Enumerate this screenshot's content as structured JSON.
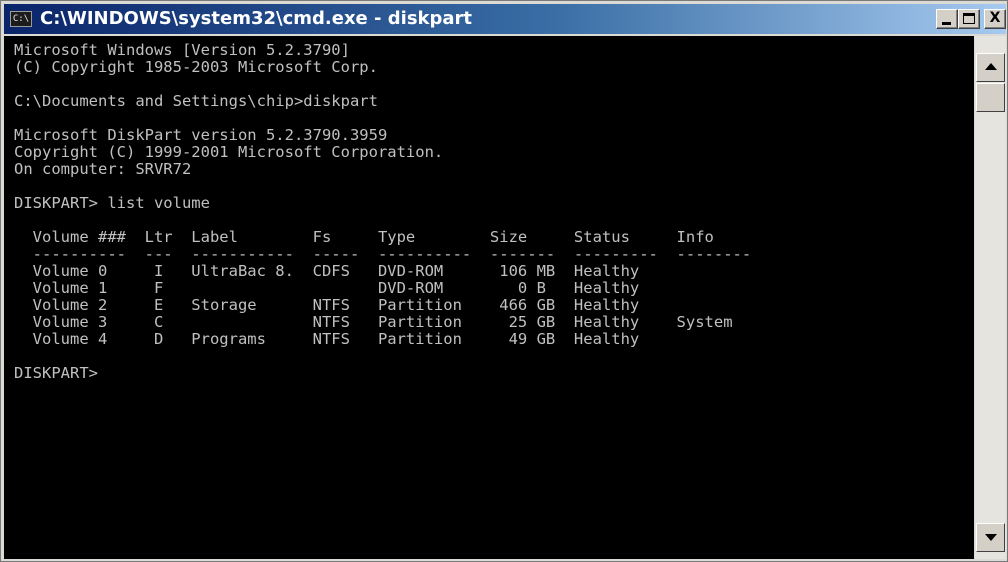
{
  "window": {
    "title": "C:\\WINDOWS\\system32\\cmd.exe - diskpart",
    "icon_text": "C:\\",
    "minimize_label": "",
    "maximize_label": "",
    "close_label": "X"
  },
  "console": {
    "lines": [
      "Microsoft Windows [Version 5.2.3790]",
      "(C) Copyright 1985-2003 Microsoft Corp.",
      "",
      "C:\\Documents and Settings\\chip>diskpart",
      "",
      "Microsoft DiskPart version 5.2.3790.3959",
      "Copyright (C) 1999-2001 Microsoft Corporation.",
      "On computer: SRVR72",
      "",
      "DISKPART> list volume",
      "",
      "  Volume ###  Ltr  Label        Fs     Type        Size     Status     Info",
      "  ----------  ---  -----------  -----  ----------  -------  ---------  --------",
      "  Volume 0     I   UltraBac 8.  CDFS   DVD-ROM      106 MB  Healthy",
      "  Volume 1     F                       DVD-ROM        0 B   Healthy",
      "  Volume 2     E   Storage      NTFS   Partition    466 GB  Healthy",
      "  Volume 3     C                NTFS   Partition     25 GB  Healthy    System",
      "  Volume 4     D   Programs     NTFS   Partition     49 GB  Healthy",
      "",
      "DISKPART> "
    ]
  },
  "colors": {
    "console_bg": "#000000",
    "console_fg": "#c0c0c0",
    "titlebar_start": "#0a246a",
    "titlebar_end": "#a6caf0"
  },
  "icons": {
    "app": "cmd-icon",
    "minimize": "minimize-icon",
    "maximize": "maximize-icon",
    "close": "close-icon",
    "scroll_up": "arrow-up-icon",
    "scroll_down": "arrow-down-icon"
  }
}
